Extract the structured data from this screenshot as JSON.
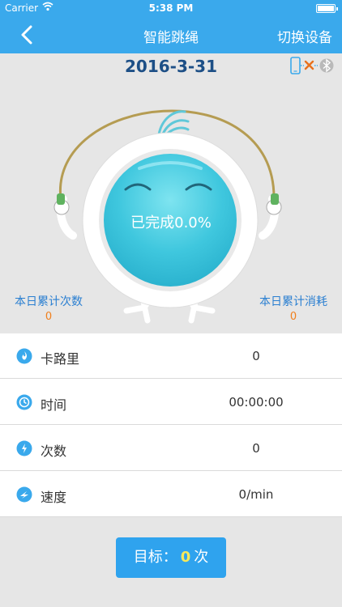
{
  "status_bar": {
    "carrier": "Carrier",
    "time": "5:38 PM"
  },
  "nav": {
    "title": "智能跳绳",
    "switch_label": "切换设备"
  },
  "date": "2016-3-31",
  "device_status": {
    "phone_icon": "phone-icon",
    "x_icon": "x-mark-icon",
    "bluetooth_icon": "bluetooth-icon"
  },
  "hero": {
    "progress_text": "已完成0.0%"
  },
  "stats": {
    "left": {
      "label": "本日累计次数",
      "value": "0"
    },
    "right": {
      "label": "本日累计消耗",
      "value": "0"
    }
  },
  "list": [
    {
      "icon": "calorie-icon",
      "label": "卡路里",
      "value": "0"
    },
    {
      "icon": "clock-icon",
      "label": "时间",
      "value": "00:00:00"
    },
    {
      "icon": "count-icon",
      "label": "次数",
      "value": "0"
    },
    {
      "icon": "speed-icon",
      "label": "速度",
      "value": "0/min"
    }
  ],
  "goal": {
    "prefix": "目标：",
    "value": "0",
    "suffix": "次"
  },
  "colors": {
    "accent": "#3aa9ec",
    "date_text": "#1d4f86",
    "stat_label": "#2a7fd1",
    "stat_value": "#f07f1c",
    "goal_number": "#f6e85a"
  }
}
